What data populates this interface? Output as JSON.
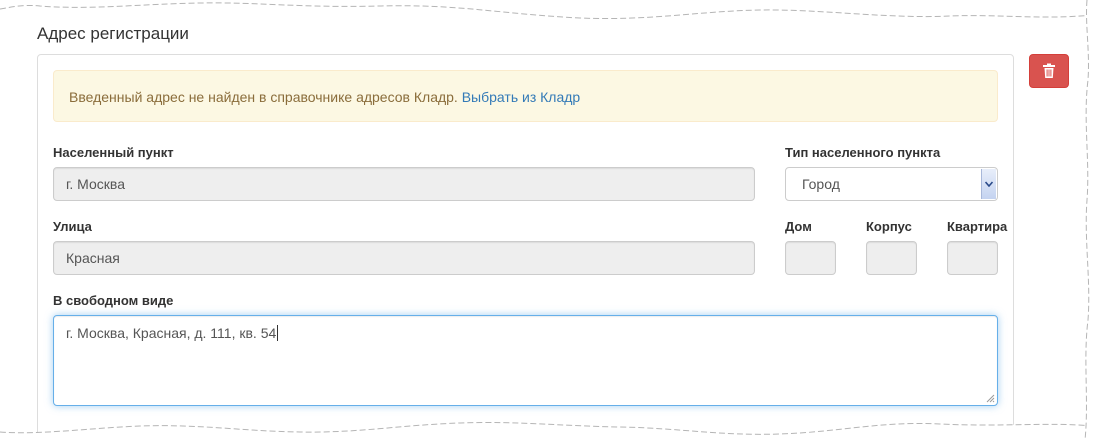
{
  "section": {
    "title": "Адрес регистрации"
  },
  "alert": {
    "message": "Введенный адрес не найден в справочнике адресов Кладр.",
    "link": "Выбрать из Кладр"
  },
  "fields": {
    "locality": {
      "label": "Населенный пункт",
      "value": "г. Москва"
    },
    "locality_type": {
      "label": "Тип населенного пункта",
      "value": "Город"
    },
    "street": {
      "label": "Улица",
      "value": "Красная"
    },
    "house": {
      "label": "Дом",
      "value": ""
    },
    "building": {
      "label": "Корпус",
      "value": ""
    },
    "apartment": {
      "label": "Квартира",
      "value": ""
    },
    "free_form": {
      "label": "В свободном виде",
      "value": "г. Москва, Красная, д. 111, кв. 54"
    }
  },
  "icons": {
    "delete": "trash-icon",
    "select_arrow": "chevron-down-icon"
  },
  "colors": {
    "danger": "#d9534f",
    "alert_bg": "#fcf8e3",
    "alert_text": "#8a6d3b",
    "link": "#337ab7",
    "focus": "#66afe9"
  }
}
